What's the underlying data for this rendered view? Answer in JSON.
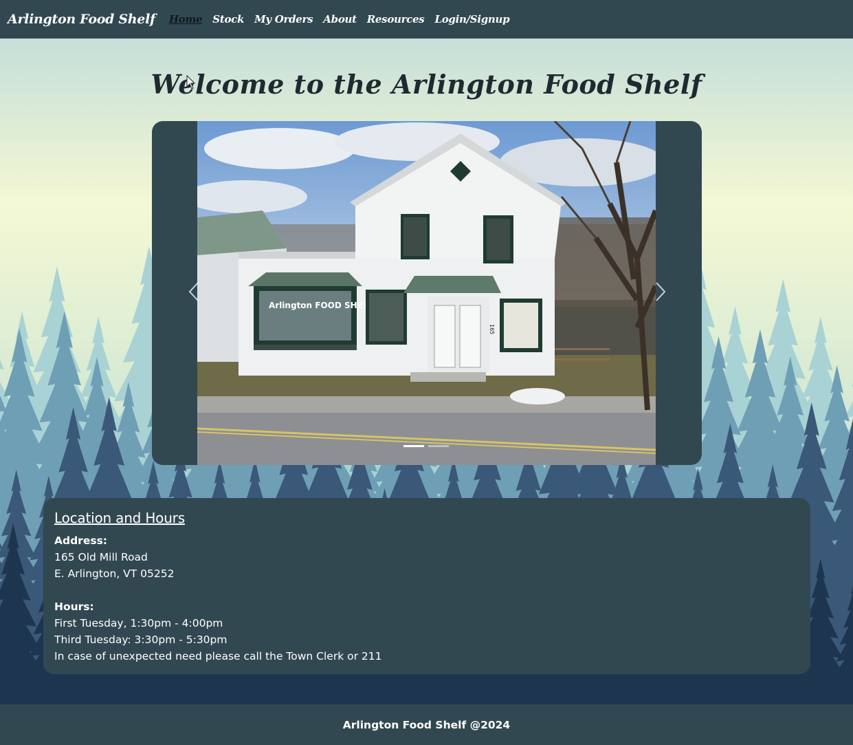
{
  "nav": {
    "brand": "Arlington Food Shelf",
    "items": [
      "Home",
      "Stock",
      "My Orders",
      "About",
      "Resources",
      "Login/Signup"
    ],
    "active": "Home"
  },
  "main": {
    "title": "Welcome to the Arlington Food Shelf"
  },
  "carousel": {
    "slides_count": 2,
    "active_index": 0,
    "prev_icon": "chevron-left-icon",
    "next_icon": "chevron-right-icon",
    "photo_sign": "Arlington FOOD SHELF",
    "photo_house_number": "165"
  },
  "location": {
    "heading": "Location and Hours",
    "address_label": "Address:",
    "address_line1": "165 Old Mill Road",
    "address_line2": "E. Arlington, VT 05252",
    "hours_label": "Hours:",
    "hours_line1": "First Tuesday, 1:30pm - 4:00pm",
    "hours_line2": "Third Tuesday: 3:30pm - 5:30pm",
    "hours_note": "In case of unexpected need please call the Town Clerk or 211"
  },
  "footer": {
    "text": "Arlington Food Shelf @2024"
  },
  "colors": {
    "panel": "#324851",
    "sky_top": "#c6dfd9",
    "sky_mid": "#f4f8d4",
    "forest_light": "#a9d2d4",
    "forest_mid": "#6f9fb5",
    "forest_dark": "#3a5878",
    "forest_darkest": "#1e3550"
  }
}
